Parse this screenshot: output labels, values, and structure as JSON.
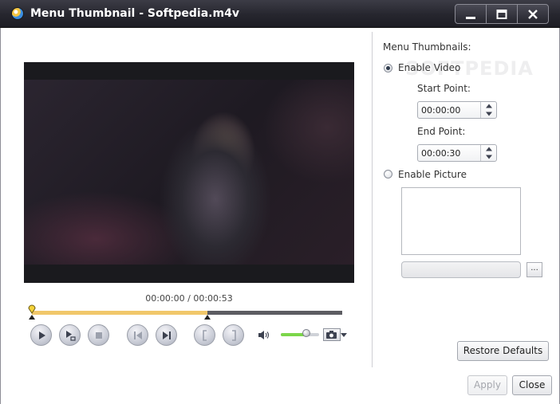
{
  "window": {
    "title": "Menu Thumbnail - Softpedia.m4v",
    "controls": [
      "minimize-icon",
      "maximize-icon",
      "close-icon"
    ]
  },
  "player": {
    "timecode": "00:00:00 / 00:00:53",
    "playhead_fraction": 0.0,
    "selection_start_fraction": 0.0,
    "selection_end_fraction": 0.566,
    "volume_fraction": 0.66,
    "buttons": [
      "play-icon",
      "play-selection-icon",
      "stop-icon",
      "previous-icon",
      "next-icon",
      "mark-in-icon",
      "mark-out-icon"
    ],
    "accent_color": "#e8a632"
  },
  "menu_thumbnails": {
    "heading": "Menu Thumbnails:",
    "enable_video": {
      "label": "Enable Video",
      "checked": true
    },
    "start_point": {
      "label": "Start Point:",
      "value": "00:00:00"
    },
    "end_point": {
      "label": "End Point:",
      "value": "00:00:30"
    },
    "enable_picture": {
      "label": "Enable Picture",
      "checked": false
    },
    "picture_path": "",
    "browse_label": "..."
  },
  "buttons": {
    "restore_defaults": "Restore Defaults",
    "apply": "Apply",
    "close": "Close"
  },
  "watermark": "SOFTPEDIA"
}
